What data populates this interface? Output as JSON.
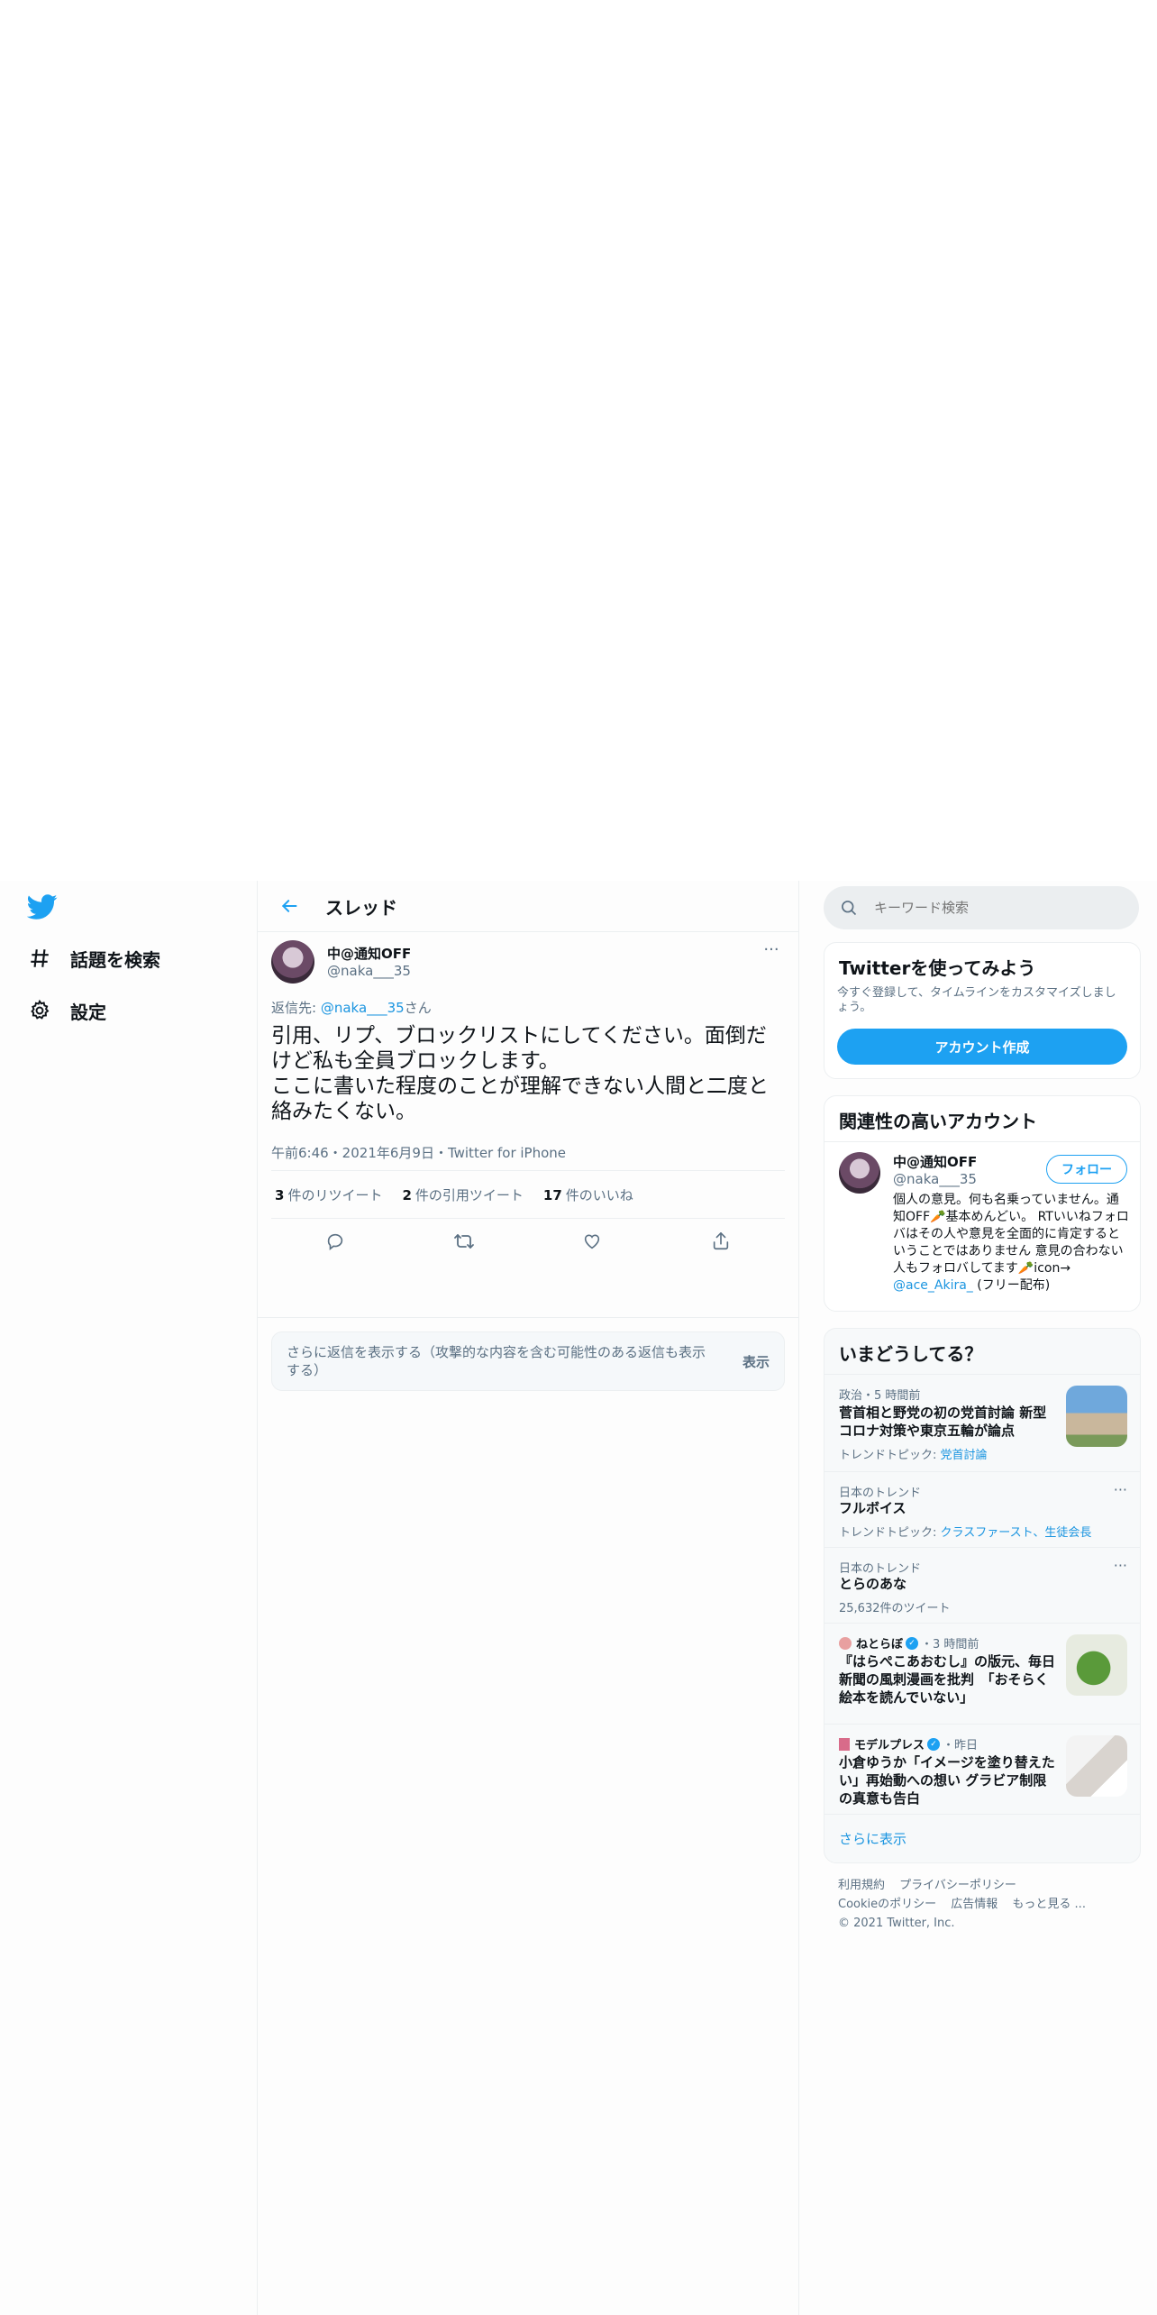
{
  "nav": {
    "logo_icon": "twitter-bird-icon",
    "items": [
      {
        "icon": "hashtag-icon",
        "label": "話題を検索"
      },
      {
        "icon": "gear-icon",
        "label": "設定"
      }
    ],
    "accent": "#1da1f2"
  },
  "thread": {
    "title": "スレッド",
    "tweet": {
      "name": "中@通知OFF",
      "handle": "@naka___35",
      "reply_prefix": "返信先: ",
      "reply_handle": "@naka___35",
      "reply_suffix": "さん",
      "text": "引用、リプ、ブロックリストにしてください。面倒だけど私も全員ブロックします。\nここに書いた程度のことが理解できない人間と二度と絡みたくない。",
      "meta": "午前6:46・2021年6月9日・Twitter for iPhone",
      "retweets_count": "3",
      "retweets_label": "件のリツイート",
      "quotes_count": "2",
      "quotes_label": "件の引用ツイート",
      "likes_count": "17",
      "likes_label": "件のいいね"
    },
    "show_more": {
      "text": "さらに返信を表示する（攻撃的な内容を含む可能性のある返信も表示する）",
      "button": "表示"
    }
  },
  "sidebar": {
    "search_placeholder": "キーワード検索",
    "signup": {
      "title": "Twitterを使ってみよう",
      "desc": "今すぐ登録して、タイムラインをカスタマイズしましょう。",
      "button": "アカウント作成"
    },
    "related": {
      "title": "関連性の高いアカウント",
      "name": "中@通知OFF",
      "handle": "@naka___35",
      "follow": "フォロー",
      "bio_prefix": "個人の意見。何も名乗っていません。通知OFF🥕基本めんどい。 RTいいねフォロバはその人や意見を全面的に肯定するということではありません 意見の合わない人もフォロバしてます🥕icon→ ",
      "bio_link": "@ace_Akira_",
      "bio_suffix": " (フリー配布)"
    },
    "trends": {
      "title": "いまどうしてる？",
      "items": [
        {
          "context": "政治・5 時間前",
          "title": "菅首相と野党の初の党首討論 新型コロナ対策や東京五輪が論点",
          "sub_prefix": "トレンドトピック: ",
          "sub_link": "党首討論"
        },
        {
          "context": "日本のトレンド",
          "title": "フルボイス",
          "sub_prefix": "トレンドトピック: ",
          "sub_link": "クラスファースト、生徒会長"
        },
        {
          "context": "日本のトレンド",
          "title": "とらのあな",
          "sub": "25,632件のツイート"
        },
        {
          "source": "ねとらぼ",
          "time": "・3 時間前",
          "title": "『はらぺこあおむし』の版元、毎日新聞の風刺漫画を批判　「おそらく絵本を読んでいない」"
        },
        {
          "source": "モデルプレス",
          "time": "・昨日",
          "title": "小倉ゆうか「イメージを塗り替えたい」再始動への想い グラビア制限の真意も告白"
        }
      ],
      "show_all": "さらに表示"
    },
    "footer": {
      "links": [
        "利用規約",
        "プライバシーポリシー",
        "Cookieのポリシー",
        "広告情報",
        "もっと見る ..."
      ],
      "copyright": "© 2021 Twitter, Inc."
    }
  }
}
